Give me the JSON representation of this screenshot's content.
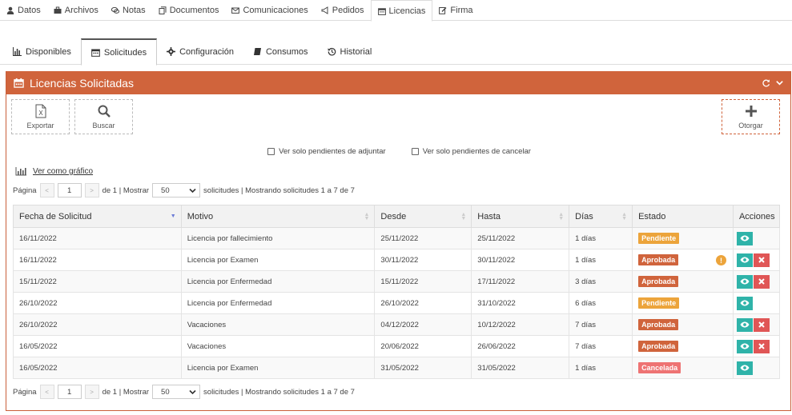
{
  "top_tabs": [
    {
      "label": "Datos",
      "icon": "user-icon"
    },
    {
      "label": "Archivos",
      "icon": "briefcase-icon"
    },
    {
      "label": "Notas",
      "icon": "comments-icon"
    },
    {
      "label": "Documentos",
      "icon": "files-icon"
    },
    {
      "label": "Comunicaciones",
      "icon": "envelope-icon"
    },
    {
      "label": "Pedidos",
      "icon": "bullhorn-icon"
    },
    {
      "label": "Licencias",
      "icon": "calendar-icon",
      "active": true
    },
    {
      "label": "Firma",
      "icon": "edit-icon"
    }
  ],
  "sub_tabs": [
    {
      "label": "Disponibles",
      "icon": "bar-chart-icon"
    },
    {
      "label": "Solicitudes",
      "icon": "calendar-icon",
      "active": true
    },
    {
      "label": "Configuración",
      "icon": "gear-icon"
    },
    {
      "label": "Consumos",
      "icon": "book-icon"
    },
    {
      "label": "Historial",
      "icon": "history-icon"
    }
  ],
  "panel": {
    "title": "Licencias Solicitadas",
    "export_label": "Exportar",
    "search_label": "Buscar",
    "grant_label": "Otorgar",
    "filter_pending_attach": "Ver solo pendientes de adjuntar",
    "filter_pending_cancel": "Ver solo pendientes de cancelar",
    "chart_link": "Ver como gráfico"
  },
  "pager": {
    "page_label": "Página",
    "page_value": "1",
    "of_text": "de 1 | Mostrar",
    "page_size": "50",
    "summary": "solicitudes | Mostrando solicitudes 1 a 7 de 7"
  },
  "table": {
    "columns": [
      "Fecha de Solicitud",
      "Motivo",
      "Desde",
      "Hasta",
      "Días",
      "Estado",
      "Acciones"
    ],
    "rows": [
      {
        "fecha": "16/11/2022",
        "motivo": "Licencia por fallecimiento",
        "desde": "25/11/2022",
        "hasta": "25/11/2022",
        "dias": "1 días",
        "estado": "Pendiente",
        "estado_class": "b-pend",
        "warn": false,
        "delete": false
      },
      {
        "fecha": "16/11/2022",
        "motivo": "Licencia por Examen",
        "desde": "30/11/2022",
        "hasta": "30/11/2022",
        "dias": "1 días",
        "estado": "Aprobada",
        "estado_class": "b-apr",
        "warn": true,
        "delete": true
      },
      {
        "fecha": "15/11/2022",
        "motivo": "Licencia por Enfermedad",
        "desde": "15/11/2022",
        "hasta": "17/11/2022",
        "dias": "3 días",
        "estado": "Aprobada",
        "estado_class": "b-apr",
        "warn": false,
        "delete": true
      },
      {
        "fecha": "26/10/2022",
        "motivo": "Licencia por Enfermedad",
        "desde": "26/10/2022",
        "hasta": "31/10/2022",
        "dias": "6 días",
        "estado": "Pendiente",
        "estado_class": "b-pend",
        "warn": false,
        "delete": false
      },
      {
        "fecha": "26/10/2022",
        "motivo": "Vacaciones",
        "desde": "04/12/2022",
        "hasta": "10/12/2022",
        "dias": "7 días",
        "estado": "Aprobada",
        "estado_class": "b-apr",
        "warn": false,
        "delete": true
      },
      {
        "fecha": "16/05/2022",
        "motivo": "Vacaciones",
        "desde": "20/06/2022",
        "hasta": "26/06/2022",
        "dias": "7 días",
        "estado": "Aprobada",
        "estado_class": "b-apr",
        "warn": false,
        "delete": true
      },
      {
        "fecha": "16/05/2022",
        "motivo": "Licencia por Examen",
        "desde": "31/05/2022",
        "hasta": "31/05/2022",
        "dias": "1 días",
        "estado": "Cancelada",
        "estado_class": "b-can",
        "warn": false,
        "delete": false
      }
    ]
  },
  "colors": {
    "accent": "#d0643c",
    "pending": "#eca43b",
    "cancelled": "#ee7373",
    "view": "#2fb3a9",
    "delete": "#e05656"
  }
}
